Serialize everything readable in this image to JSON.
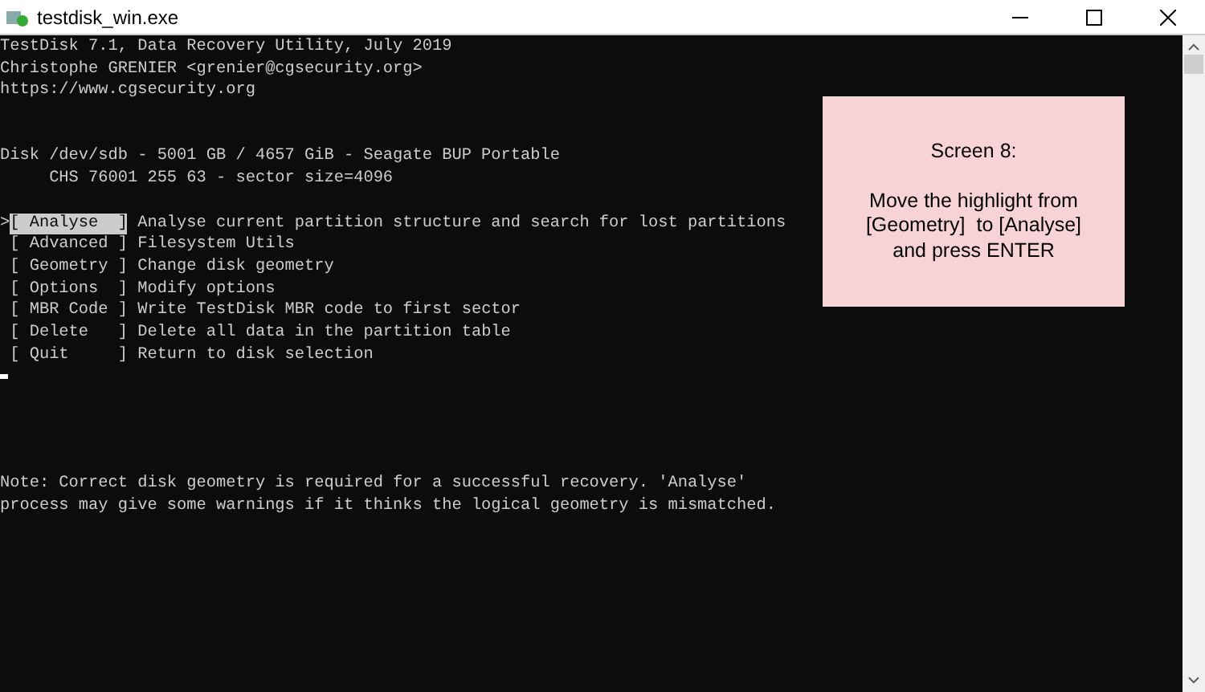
{
  "window": {
    "title": "testdisk_win.exe"
  },
  "header_lines": [
    "TestDisk 7.1, Data Recovery Utility, July 2019",
    "Christophe GRENIER <grenier@cgsecurity.org>",
    "https://www.cgsecurity.org"
  ],
  "disk_lines": [
    "Disk /dev/sdb - 5001 GB / 4657 GiB - Seagate BUP Portable",
    "     CHS 76001 255 63 - sector size=4096"
  ],
  "menu": [
    {
      "pointer": ">",
      "label": "[ Analyse  ]",
      "description": "Analyse current partition structure and search for lost partitions",
      "selected": true
    },
    {
      "label": "[ Advanced ]",
      "description": "Filesystem Utils",
      "selected": false
    },
    {
      "label": "[ Geometry ]",
      "description": "Change disk geometry",
      "selected": false
    },
    {
      "label": "[ Options  ]",
      "description": "Modify options",
      "selected": false
    },
    {
      "label": "[ MBR Code ]",
      "description": "Write TestDisk MBR code to first sector",
      "selected": false
    },
    {
      "label": "[ Delete   ]",
      "description": "Delete all data in the partition table",
      "selected": false
    },
    {
      "label": "[ Quit     ]",
      "description": "Return to disk selection",
      "selected": false
    }
  ],
  "note_lines": [
    "Note: Correct disk geometry is required for a successful recovery. 'Analyse'",
    "process may give some warnings if it thinks the logical geometry is mismatched."
  ],
  "callout": {
    "title": "Screen 8:",
    "lines": [
      "Move the highlight from",
      "[Geometry]  to [Analyse]",
      "and press ENTER"
    ]
  }
}
